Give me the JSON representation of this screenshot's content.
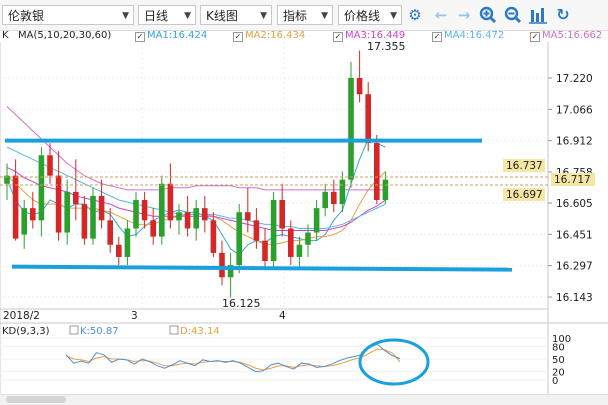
{
  "toolbar": {
    "dropdowns": [
      {
        "name": "symbol-select",
        "label": "伦敦银"
      },
      {
        "name": "period-select",
        "label": "日线"
      },
      {
        "name": "chart-type-select",
        "label": "K线图"
      },
      {
        "name": "indicator-select",
        "label": "指标"
      },
      {
        "name": "price-line-select",
        "label": "价格线"
      }
    ],
    "icons": [
      "settings-icon",
      "back-icon",
      "forward-icon",
      "zoom-in-icon",
      "zoom-out-icon",
      "bar-chart-icon",
      "refresh-icon"
    ]
  },
  "ma_legend": {
    "prefix": "K",
    "params": "MA(5,10,20,30,60)",
    "items": [
      {
        "label": "MA1:16.424",
        "color": "#33a6d8"
      },
      {
        "label": "MA2:16.434",
        "color": "#e8a040"
      },
      {
        "label": "MA3:16.449",
        "color": "#cc44cc"
      },
      {
        "label": "MA4:16.472",
        "color": "#5ab8e0"
      },
      {
        "label": "MA5:16.662",
        "color": "#d070c8"
      }
    ]
  },
  "kd_legend": {
    "params": "KD(9,3,3)",
    "k_label": "K:50.87",
    "k_color": "#4f8fd8",
    "d_label": "D:43.14",
    "d_color": "#e8a040"
  },
  "price_labels": {
    "high_marker": "17.355",
    "low_marker": "16.125",
    "tag_upper": "16.737",
    "tag_current": "16.717",
    "tag_lower": "16.697"
  },
  "x_labels": [
    "2018/2",
    "3",
    "4"
  ],
  "chart_data": {
    "type": "candlestick",
    "y_axis_ticks": [
      17.22,
      17.066,
      16.912,
      16.758,
      16.605,
      16.451,
      16.297,
      16.143
    ],
    "y_axis_labels": [
      "17.220",
      "17.066",
      "16.912",
      "16.758",
      "16.605",
      "16.451",
      "16.297",
      "16.143"
    ],
    "kd_axis_labels": [
      "100",
      "80",
      "50",
      "20",
      "0"
    ],
    "candles": [
      [
        16.7,
        16.8,
        16.62,
        16.74
      ],
      [
        16.74,
        16.82,
        16.42,
        16.43
      ],
      [
        16.45,
        16.62,
        16.38,
        16.58
      ],
      [
        16.58,
        16.66,
        16.48,
        16.52
      ],
      [
        16.52,
        16.88,
        16.44,
        16.84
      ],
      [
        16.84,
        16.9,
        16.7,
        16.74
      ],
      [
        16.74,
        16.86,
        16.42,
        16.46
      ],
      [
        16.46,
        16.72,
        16.4,
        16.66
      ],
      [
        16.66,
        16.82,
        16.52,
        16.6
      ],
      [
        16.6,
        16.64,
        16.4,
        16.43
      ],
      [
        16.43,
        16.68,
        16.4,
        16.64
      ],
      [
        16.64,
        16.72,
        16.48,
        16.52
      ],
      [
        16.52,
        16.58,
        16.36,
        16.4
      ],
      [
        16.4,
        16.44,
        16.3,
        16.34
      ],
      [
        16.34,
        16.52,
        16.3,
        16.48
      ],
      [
        16.48,
        16.66,
        16.44,
        16.62
      ],
      [
        16.62,
        16.66,
        16.48,
        16.52
      ],
      [
        16.52,
        16.58,
        16.4,
        16.44
      ],
      [
        16.44,
        16.74,
        16.4,
        16.7
      ],
      [
        16.7,
        16.8,
        16.48,
        16.52
      ],
      [
        16.52,
        16.6,
        16.45,
        16.56
      ],
      [
        16.56,
        16.64,
        16.44,
        16.48
      ],
      [
        16.48,
        16.62,
        16.42,
        16.58
      ],
      [
        16.58,
        16.64,
        16.46,
        16.52
      ],
      [
        16.52,
        16.56,
        16.34,
        16.36
      ],
      [
        16.36,
        16.42,
        16.2,
        16.24
      ],
      [
        16.24,
        16.36,
        16.14,
        16.3
      ],
      [
        16.3,
        16.6,
        16.26,
        16.56
      ],
      [
        16.56,
        16.68,
        16.46,
        16.52
      ],
      [
        16.52,
        16.58,
        16.38,
        16.42
      ],
      [
        16.42,
        16.48,
        16.28,
        16.32
      ],
      [
        16.32,
        16.66,
        16.28,
        16.62
      ],
      [
        16.62,
        16.7,
        16.44,
        16.48
      ],
      [
        16.48,
        16.52,
        16.3,
        16.34
      ],
      [
        16.34,
        16.44,
        16.28,
        16.4
      ],
      [
        16.4,
        16.5,
        16.34,
        16.46
      ],
      [
        16.46,
        16.62,
        16.42,
        16.58
      ],
      [
        16.58,
        16.7,
        16.54,
        16.66
      ],
      [
        16.66,
        16.72,
        16.56,
        16.6
      ],
      [
        16.6,
        16.76,
        16.56,
        16.72
      ],
      [
        16.72,
        17.3,
        16.68,
        17.22
      ],
      [
        17.22,
        17.355,
        17.1,
        17.14
      ],
      [
        17.14,
        17.2,
        16.86,
        16.9
      ],
      [
        16.9,
        16.94,
        16.6,
        16.62
      ],
      [
        16.62,
        16.76,
        16.6,
        16.72
      ]
    ],
    "ma_lines_approx": [
      {
        "name": "MA1",
        "color": "#33a6d8",
        "values": [
          16.72,
          16.62,
          16.56,
          16.55,
          16.56,
          16.62,
          16.6,
          16.58,
          16.6,
          16.6,
          16.56,
          16.57,
          16.55,
          16.49,
          16.44,
          16.45,
          16.49,
          16.52,
          16.54,
          16.56,
          16.57,
          16.56,
          16.56,
          16.54,
          16.52,
          16.45,
          16.38,
          16.35,
          16.4,
          16.42,
          16.41,
          16.44,
          16.45,
          16.44,
          16.43,
          16.42,
          16.42,
          16.45,
          16.52,
          16.57,
          16.7,
          16.82,
          16.92,
          16.9,
          16.88
        ]
      },
      {
        "name": "MA2",
        "color": "#e8a040",
        "values": [
          16.74,
          16.7,
          16.66,
          16.62,
          16.6,
          16.6,
          16.6,
          16.58,
          16.58,
          16.58,
          16.58,
          16.57,
          16.56,
          16.54,
          16.52,
          16.5,
          16.5,
          16.5,
          16.52,
          16.53,
          16.54,
          16.55,
          16.55,
          16.55,
          16.54,
          16.52,
          16.49,
          16.46,
          16.44,
          16.42,
          16.4,
          16.4,
          16.41,
          16.42,
          16.42,
          16.43,
          16.44,
          16.44,
          16.45,
          16.47,
          16.52,
          16.6,
          16.67,
          16.72,
          16.76
        ]
      },
      {
        "name": "MA3",
        "color": "#cc44cc",
        "values": [
          16.78,
          16.76,
          16.73,
          16.71,
          16.69,
          16.68,
          16.67,
          16.66,
          16.64,
          16.63,
          16.62,
          16.61,
          16.6,
          16.58,
          16.57,
          16.56,
          16.55,
          16.54,
          16.54,
          16.54,
          16.54,
          16.54,
          16.54,
          16.54,
          16.54,
          16.53,
          16.52,
          16.51,
          16.5,
          16.49,
          16.48,
          16.47,
          16.47,
          16.47,
          16.47,
          16.47,
          16.47,
          16.47,
          16.48,
          16.49,
          16.51,
          16.54,
          16.57,
          16.59,
          16.62
        ]
      },
      {
        "name": "MA4",
        "color": "#5ab8e0",
        "values": [
          16.88,
          16.86,
          16.84,
          16.82,
          16.8,
          16.78,
          16.76,
          16.74,
          16.72,
          16.7,
          16.68,
          16.66,
          16.64,
          16.62,
          16.61,
          16.6,
          16.59,
          16.58,
          16.57,
          16.56,
          16.55,
          16.55,
          16.55,
          16.55,
          16.55,
          16.54,
          16.53,
          16.53,
          16.52,
          16.51,
          16.5,
          16.5,
          16.49,
          16.49,
          16.48,
          16.48,
          16.48,
          16.48,
          16.49,
          16.5,
          16.52,
          16.54,
          16.56,
          16.58,
          16.6
        ]
      },
      {
        "name": "MA5",
        "color": "#d070c8",
        "values": [
          17.08,
          17.04,
          17.0,
          16.96,
          16.92,
          16.88,
          16.84,
          16.8,
          16.77,
          16.74,
          16.72,
          16.7,
          16.69,
          16.68,
          16.67,
          16.67,
          16.67,
          16.67,
          16.67,
          16.68,
          16.68,
          16.68,
          16.69,
          16.69,
          16.69,
          16.69,
          16.69,
          16.68,
          16.68,
          16.68,
          16.67,
          16.67,
          16.67,
          16.67,
          16.67,
          16.67,
          16.67,
          16.67,
          16.67,
          16.67,
          16.67,
          16.67,
          16.67,
          16.67,
          16.67
        ]
      }
    ],
    "kd_k": [
      60,
      40,
      45,
      40,
      65,
      60,
      42,
      50,
      48,
      38,
      50,
      44,
      34,
      28,
      36,
      46,
      40,
      34,
      48,
      44,
      46,
      42,
      46,
      40,
      30,
      20,
      22,
      36,
      40,
      32,
      26,
      40,
      38,
      30,
      32,
      38,
      46,
      52,
      56,
      60,
      78,
      85,
      70,
      58,
      50.87
    ],
    "kd_d": [
      58,
      50,
      48,
      44,
      52,
      56,
      50,
      50,
      48,
      44,
      46,
      45,
      40,
      34,
      34,
      38,
      40,
      38,
      42,
      44,
      45,
      44,
      44,
      42,
      36,
      28,
      24,
      28,
      34,
      34,
      30,
      34,
      36,
      34,
      32,
      34,
      38,
      44,
      50,
      54,
      64,
      74,
      72,
      64,
      43.14
    ],
    "support_line": 16.297,
    "resistance_line": 16.912
  }
}
